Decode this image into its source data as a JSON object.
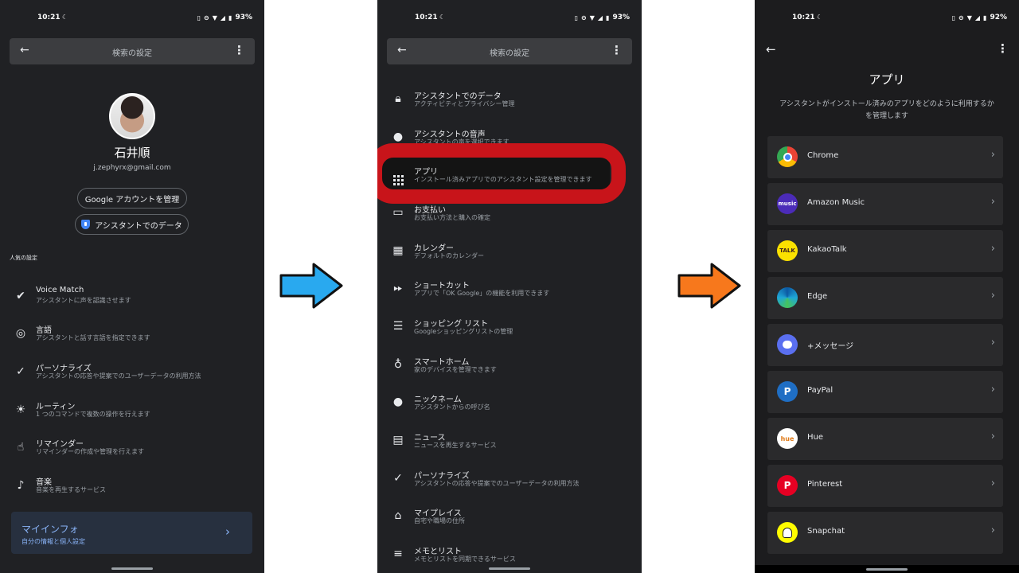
{
  "colors": {
    "blue_arrow": "#29a9ef",
    "orange_arrow": "#f7781c",
    "highlight": "#c8141a",
    "link_blue": "#8ab4f8"
  },
  "panel1": {
    "status": {
      "time": "10:21",
      "battery": "93%"
    },
    "search_title": "検索の設定",
    "profile": {
      "name": "石井順",
      "email": "j.zephyrx@gmail.com"
    },
    "manage_account": "Google アカウントを管理",
    "assistant_data": "アシスタントでのデータ",
    "section_heading": "人気の設定",
    "items": [
      {
        "icon": "check-circle-icon",
        "title": "Voice Match",
        "subtitle": "アシスタントに声を認識させます"
      },
      {
        "icon": "globe-icon",
        "title": "言語",
        "subtitle": "アシスタントと話す言語を指定できます"
      },
      {
        "icon": "person-check-icon",
        "title": "パーソナライズ",
        "subtitle": "アシスタントの応答や提案でのユーザーデータの利用方法"
      },
      {
        "icon": "sun-icon",
        "title": "ルーティン",
        "subtitle": "1 つのコマンドで複数の操作を行えます"
      },
      {
        "icon": "hand-icon",
        "title": "リマインダー",
        "subtitle": "リマインダーの作成や管理を行えます"
      },
      {
        "icon": "music-note-icon",
        "title": "音楽",
        "subtitle": "音楽を再生するサービス"
      }
    ],
    "info_card": {
      "title": "マイインフォ",
      "subtitle": "自分の情報と個人設定"
    }
  },
  "panel2": {
    "status": {
      "time": "10:21",
      "battery": "93%"
    },
    "search_title": "検索の設定",
    "items": [
      {
        "icon": "lock-icon",
        "title": "アシスタントでのデータ",
        "subtitle": "アクティビティとプライバシー管理"
      },
      {
        "icon": "voice-icon",
        "title": "アシスタントの音声",
        "subtitle": "アシスタントの声を選択できます"
      },
      {
        "icon": "apps-grid-icon",
        "title": "アプリ",
        "subtitle": "インストール済みアプリでのアシスタント設定を管理できます"
      },
      {
        "icon": "card-icon",
        "title": "お支払い",
        "subtitle": "お支払い方法と購入の確定"
      },
      {
        "icon": "calendar-icon",
        "title": "カレンダー",
        "subtitle": "デフォルトのカレンダー"
      },
      {
        "icon": "fast-forward-icon",
        "title": "ショートカット",
        "subtitle": "アプリで「OK Google」の機能を利用できます"
      },
      {
        "icon": "list-icon",
        "title": "ショッピング リスト",
        "subtitle": "Googleショッピングリストの管理"
      },
      {
        "icon": "bulb-icon",
        "title": "スマートホーム",
        "subtitle": "家のデバイスを管理できます"
      },
      {
        "icon": "person-icon",
        "title": "ニックネーム",
        "subtitle": "アシスタントからの呼び名"
      },
      {
        "icon": "news-icon",
        "title": "ニュース",
        "subtitle": "ニュースを再生するサービス"
      },
      {
        "icon": "person-check-icon",
        "title": "パーソナライズ",
        "subtitle": "アシスタントの応答や提案でのユーザーデータの利用方法"
      },
      {
        "icon": "home-icon",
        "title": "マイプレイス",
        "subtitle": "自宅や職場の住所"
      },
      {
        "icon": "notes-icon",
        "title": "メモとリスト",
        "subtitle": "メモとリストを同期できるサービス"
      }
    ]
  },
  "panel3": {
    "status": {
      "time": "10:21",
      "battery": "92%"
    },
    "title": "アプリ",
    "description": "アシスタントがインストール済みのアプリをどのように利用するかを管理します",
    "apps": [
      {
        "name": "Chrome",
        "icon": "chrome-icon",
        "color": "#4285f4"
      },
      {
        "name": "Amazon Music",
        "icon": "amazon-music-icon",
        "color": "#4b2bb8",
        "badge": "music"
      },
      {
        "name": "KakaoTalk",
        "icon": "kakaotalk-icon",
        "color": "#fae100",
        "badge": "TALK"
      },
      {
        "name": "Edge",
        "icon": "edge-icon",
        "color": "#1fa7d6"
      },
      {
        "name": "+メッセージ",
        "icon": "plus-message-icon",
        "color": "#5a6ff0"
      },
      {
        "name": "PayPal",
        "icon": "paypal-icon",
        "color": "#1f6ec4",
        "badge": "P"
      },
      {
        "name": "Hue",
        "icon": "hue-icon",
        "color": "#ffffff",
        "badge": "hue"
      },
      {
        "name": "Pinterest",
        "icon": "pinterest-icon",
        "color": "#e60023",
        "badge": "P"
      },
      {
        "name": "Snapchat",
        "icon": "snapchat-icon",
        "color": "#fffc00"
      }
    ]
  }
}
